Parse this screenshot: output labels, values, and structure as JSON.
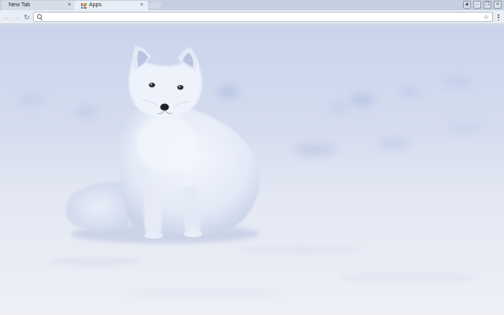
{
  "tabs": [
    {
      "title": "New Tab",
      "active": false
    },
    {
      "title": "Apps",
      "active": true
    }
  ],
  "tab_close_glyph": "×",
  "window_controls": [
    {
      "icon": "person-icon",
      "glyph": "◉"
    },
    {
      "icon": "minimize-icon",
      "glyph": "–"
    },
    {
      "icon": "restore-icon",
      "glyph": "❐"
    },
    {
      "icon": "close-icon",
      "glyph": "✕"
    }
  ],
  "toolbar": {
    "back_glyph": "←",
    "forward_glyph": "→",
    "reload_glyph": "↻",
    "bookmark_glyph": "☆"
  },
  "omnibox": {
    "value": "",
    "placeholder": ""
  },
  "apps_icon_colors": [
    "#ea4335",
    "#fbbc05",
    "#34a853",
    "#4285f4",
    "#ea4335",
    "#fbbc05",
    "#34a853",
    "#4285f4",
    "#ea4335"
  ],
  "colors": {
    "tabstrip": "#c5cfe0",
    "toolbar": "#e9eef6",
    "fox_fur": "#eef2fb",
    "snow": "#e4e8f3"
  }
}
